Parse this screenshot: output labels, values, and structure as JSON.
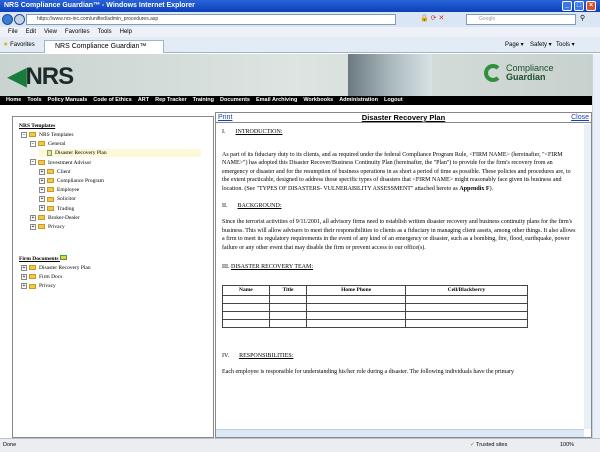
{
  "browser": {
    "title": "NRS Compliance Guardian™ - Windows Internet Explorer",
    "url": "https://www.nrs-inc.com/unified/admin_procedures.asp",
    "search_placeholder": "Google",
    "menu": [
      "File",
      "Edit",
      "View",
      "Favorites",
      "Tools",
      "Help"
    ],
    "favorites_label": "Favorites",
    "tab_label": "NRS Compliance Guardian™",
    "command_bar": [
      "Page ▾",
      "Safety ▾",
      "Tools ▾"
    ],
    "status_text": "Done",
    "zone": "Trusted sites",
    "zoom": "100%"
  },
  "header": {
    "logo": "NRS",
    "brand_line1": "Compliance",
    "brand_line2": "Guardian"
  },
  "nav": [
    "Home",
    "Tools",
    "Policy Manuals",
    "Code of Ethics",
    "ART",
    "Rep Tracker",
    "Training",
    "Documents",
    "Email Archiving",
    "Workbooks",
    "Administration",
    "Logout"
  ],
  "tree": {
    "templates_heading": "NRS Templates",
    "templates": [
      {
        "label": "NRS Templates",
        "level": 0,
        "toggle": "−",
        "type": "folder"
      },
      {
        "label": "General",
        "level": 1,
        "toggle": "−",
        "type": "folder"
      },
      {
        "label": "Disaster Recovery Plan",
        "level": 2,
        "toggle": "",
        "type": "doc",
        "selected": true
      },
      {
        "label": "Investment Advisor",
        "level": 1,
        "toggle": "−",
        "type": "folder"
      },
      {
        "label": "Client",
        "level": 2,
        "toggle": "+",
        "type": "folder"
      },
      {
        "label": "Compliance Program",
        "level": 2,
        "toggle": "+",
        "type": "folder"
      },
      {
        "label": "Employee",
        "level": 2,
        "toggle": "+",
        "type": "folder"
      },
      {
        "label": "Solicitor",
        "level": 2,
        "toggle": "+",
        "type": "folder"
      },
      {
        "label": "Trading",
        "level": 2,
        "toggle": "+",
        "type": "folder"
      },
      {
        "label": "Broker-Dealer",
        "level": 1,
        "toggle": "+",
        "type": "folder"
      },
      {
        "label": "Privacy",
        "level": 1,
        "toggle": "+",
        "type": "folder"
      }
    ],
    "firm_heading": "Firm Documents",
    "firm": [
      {
        "label": "Disaster Recovery Plan",
        "toggle": "+"
      },
      {
        "label": "Firm Docs",
        "toggle": "+"
      },
      {
        "label": "Privacy",
        "toggle": "+"
      }
    ]
  },
  "document": {
    "print": "Print",
    "title": "Disaster Recovery Plan",
    "close": "Close",
    "s1_num": "I.",
    "s1_title": "INTRODUCTION:",
    "p1": "As part of its fiduciary duty to its clients, and as required under the federal Compliance Program Rule, <FIRM NAME> (hereinafter, \"<FIRM NAME>\") has adopted this Disaster Recover/Business Continuity Plan (hereinafter, the \"Plan\") to provide for the firm's recovery from an emergency or disaster and for the resumption of business operations in as short a period of time as possible. These policies and procedures are, to the extent practicable, designed to address those specific types of disasters that <FIRM NAME> might reasonably face given its business and location. (See \"TYPES OF DISASTERS- VULNERABILITY ASSESSMENT\" attached hereto as ",
    "p1_bold": "Appendix F",
    "p1_end": ").",
    "s2_num": "II.",
    "s2_title": "BACKGROUND:",
    "p2": "Since the terrorist activities of 9/11/2001, all advisory firms need to establish written disaster recovery and business continuity plans for the firm's business. This will allow advisers to meet their responsibilities to clients as a fiduciary in managing client assets, among other things. It also allows a firm to meet its regulatory requirements in the event of any kind of an emergency or disaster, such as a bombing, fire, flood, earthquake, power failure or any other event that may disable the firm or prevent access to our office(s).",
    "s3_num": "III.",
    "s3_title": "DISASTER RECOVERY TEAM:",
    "team_columns": [
      "Name",
      "Title",
      "Home Phone",
      "Cell/Blackberry"
    ],
    "s4_num": "IV.",
    "s4_title": "RESPONSIBILITIES:",
    "p4": "Each employee is responsible for understanding his/her role during a disaster. The following individuals have the primary"
  }
}
